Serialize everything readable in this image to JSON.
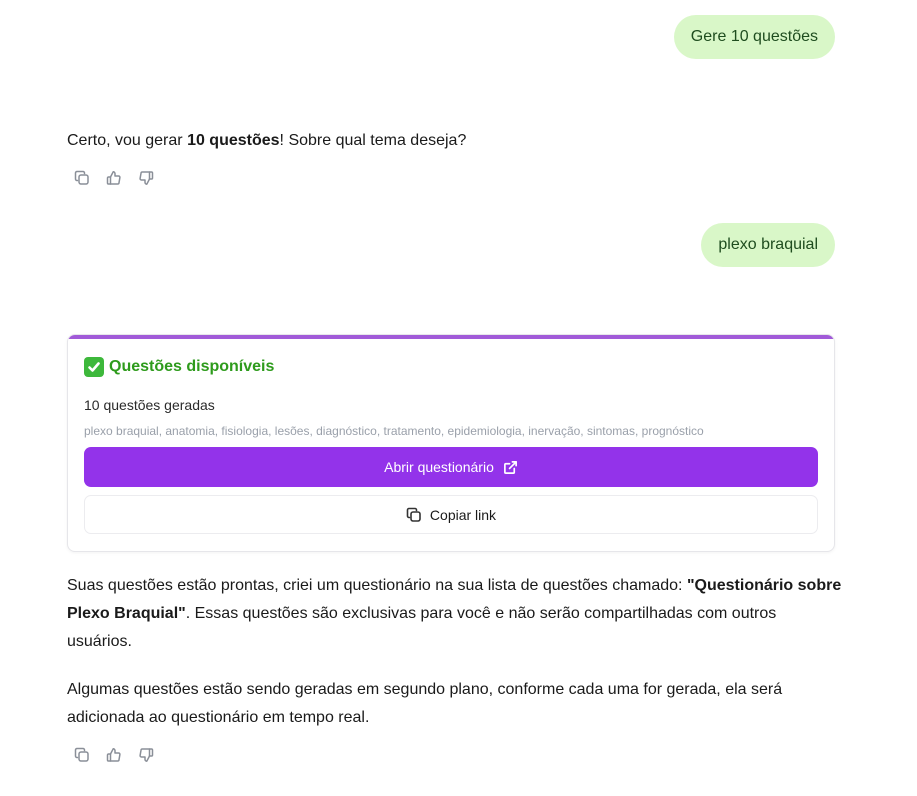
{
  "messages": {
    "user_1": "Gere 10 questões",
    "assistant_1": {
      "prefix": "Certo, vou gerar ",
      "bold": "10 questões",
      "suffix": "! Sobre qual tema deseja?"
    },
    "user_2": "plexo braquial",
    "assistant_2": {
      "p1_prefix": "Suas questões estão prontas, criei um questionário na sua lista de questões chamado: ",
      "p1_bold": "\"Questionário sobre Plexo Braquial\"",
      "p1_suffix": ". Essas questões são exclusivas para você e não serão compartilhadas com outros usuários.",
      "p2": "Algumas questões estão sendo geradas em segundo plano, conforme cada uma for gerada, ela será adicionada ao questionário em tempo real."
    }
  },
  "quiz_card": {
    "title": "Questões disponíveis",
    "count_label": "10 questões geradas",
    "tags": "plexo braquial, anatomia, fisiologia, lesões, diagnóstico, tratamento, epidemiologia, inervação, sintomas, prognóstico",
    "open_label": "Abrir questionário",
    "copy_label": "Copiar link"
  },
  "icons": {
    "copy": "copy-icon",
    "like": "thumbs-up-icon",
    "dislike": "thumbs-down-icon",
    "external": "external-link-icon",
    "check": "check-mark-icon"
  },
  "colors": {
    "user_bubble": "#d9f7c8",
    "accent": "#9333ea",
    "card_top": "#a15ad8",
    "success": "#2e9b1c"
  }
}
